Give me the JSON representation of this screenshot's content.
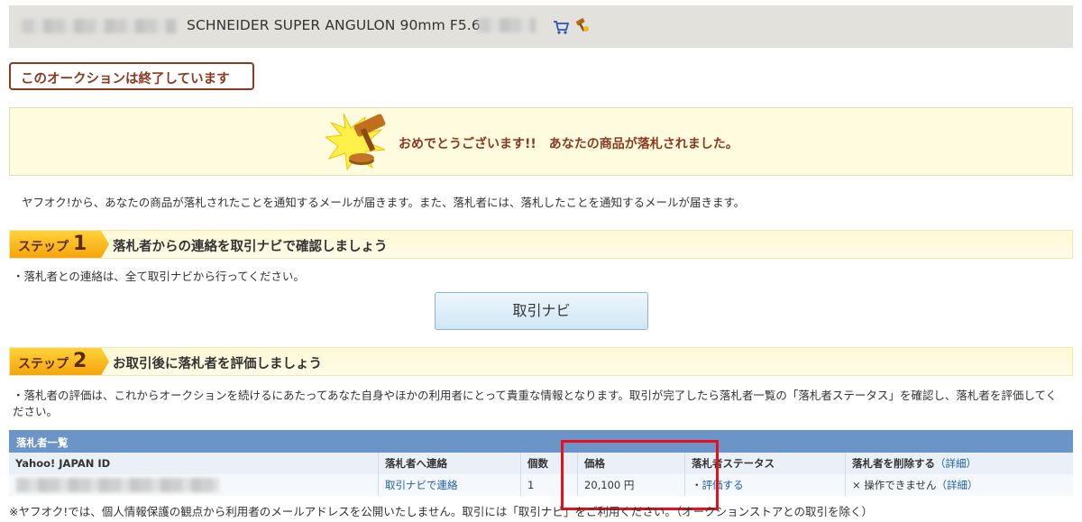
{
  "header": {
    "item_title": "SCHNEIDER SUPER ANGULON 90mm F5.6",
    "icons": [
      "cart-icon",
      "hammer-icon"
    ]
  },
  "ended_label": "このオークションは終了しています",
  "congrats": {
    "message": "おめでとうございます!!　あなたの商品が落札されました。",
    "icon": "gavel-burst-icon"
  },
  "notice": "ヤフオク!から、あなたの商品が落札されたことを通知するメールが届きます。また、落札者には、落札したことを通知するメールが届きます。",
  "step1": {
    "tag": "ステップ",
    "num": "1",
    "title": "落札者からの連絡を取引ナビで確認しましょう",
    "bullet": "・落札者との連絡は、全て取引ナビから行ってください。",
    "button": "取引ナビ"
  },
  "step2": {
    "tag": "ステップ",
    "num": "2",
    "title": "お取引後に落札者を評価しましょう",
    "bullet": "・落札者の評価は、これからオークションを続けるにあたってあなた自身やほかの利用者にとって貴重な情報となります。取引が完了したら落札者一覧の「落札者ステータス」を確認し、落札者を評価してください。"
  },
  "table": {
    "title": "落札者一覧",
    "headers": {
      "id": "Yahoo! JAPAN ID",
      "contact": "落札者へ連絡",
      "qty": "個数",
      "price": "価格",
      "status": "落札者ステータス",
      "delete": "落札者を削除する",
      "delete_link": "（詳細）"
    },
    "row": {
      "contact": "取引ナビで連絡",
      "qty": "1",
      "price": "20,100 円",
      "status_prefix": "・",
      "status_link": "評価する",
      "delete": "× 操作できません",
      "delete_link": "（詳細）"
    }
  },
  "footer": "※ヤフオク!では、個人情報保護の観点から利用者のメールアドレスを公開いたしません。取引には「取引ナビ」をご利用ください。（オークションストアとの取引を除く）",
  "colors": {
    "accent_brown": "#8b3a1f",
    "table_header": "#6b95c9",
    "highlight_red": "#e60f1b",
    "link_blue": "#1a5ea8"
  }
}
